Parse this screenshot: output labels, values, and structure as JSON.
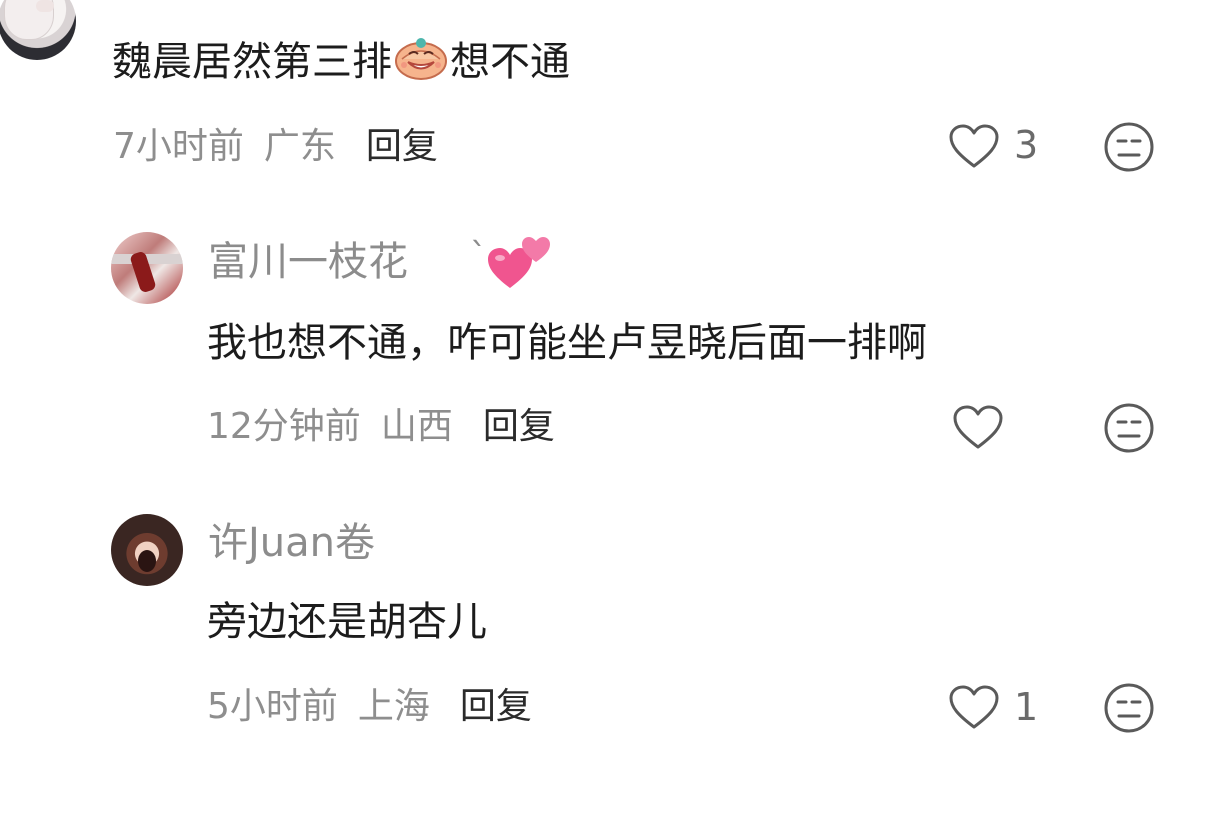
{
  "comments": [
    {
      "text_before_emoji": "魏晨居然第三排",
      "text_after_emoji": "想不通",
      "inline_emoji": "grinning-face-emoji",
      "time": "7小时前",
      "location": "广东",
      "reply_label": "回复",
      "like_count": "3"
    }
  ],
  "replies": [
    {
      "username": "富川一枝花",
      "username_suffix": "`",
      "username_emoji": "two-hearts-emoji",
      "text": "我也想不通，咋可能坐卢昱晓后面一排啊",
      "time": "12分钟前",
      "location": "山西",
      "reply_label": "回复",
      "like_count": ""
    },
    {
      "username": "许Juan卷",
      "text": "旁边还是胡杏儿",
      "time": "5小时前",
      "location": "上海",
      "reply_label": "回复",
      "like_count": "1"
    }
  ],
  "icons": {
    "like": "heart-outline-icon",
    "dislike": "meh-face-icon"
  },
  "colors": {
    "text_primary": "#1c1c1c",
    "text_secondary": "#8e8e8e",
    "icon_stroke": "#5a5a5a",
    "heart_emoji": "#f0558f"
  }
}
